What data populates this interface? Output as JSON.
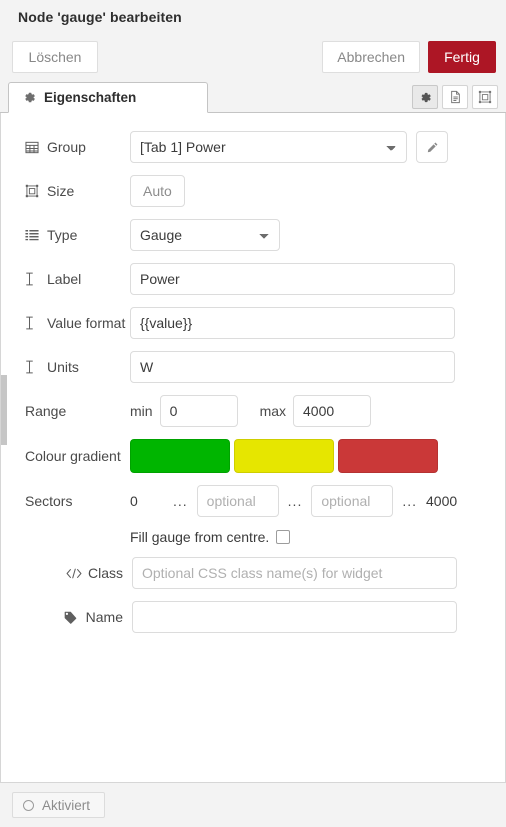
{
  "dialog": {
    "title": "Node 'gauge' bearbeiten"
  },
  "toolbar": {
    "delete_label": "Löschen",
    "cancel_label": "Abbrechen",
    "done_label": "Fertig"
  },
  "tabs": {
    "properties_label": "Eigenschaften",
    "tools": [
      {
        "name": "gear-icon",
        "active": true
      },
      {
        "name": "description-icon",
        "active": false
      },
      {
        "name": "appearance-icon",
        "active": false
      }
    ]
  },
  "form": {
    "group": {
      "label": "Group",
      "icon": "table-icon",
      "value": "[Tab 1] Power",
      "edit_button": "pencil-icon"
    },
    "size": {
      "label": "Size",
      "icon": "resize-icon",
      "value": "Auto"
    },
    "type": {
      "label": "Type",
      "icon": "list-icon",
      "value": "Gauge"
    },
    "label_field": {
      "label": "Label",
      "icon": "text-cursor-icon",
      "value": "Power"
    },
    "value_format": {
      "label": "Value format",
      "icon": "text-cursor-icon",
      "value": "{{value}}"
    },
    "units": {
      "label": "Units",
      "icon": "text-cursor-icon",
      "value": "W"
    },
    "range": {
      "label": "Range",
      "min_label": "min",
      "min_value": "0",
      "max_label": "max",
      "max_value": "4000"
    },
    "colour_gradient": {
      "label": "Colour gradient",
      "colours": [
        "#00b500",
        "#e6e600",
        "#ca3838"
      ]
    },
    "sectors": {
      "label": "Sectors",
      "start": "0",
      "separator": "...",
      "optional_1_placeholder": "optional",
      "optional_1_value": "",
      "optional_2_placeholder": "optional",
      "optional_2_value": "",
      "end": "4000"
    },
    "fill_from_centre": {
      "label": "Fill gauge from centre.",
      "checked": false
    },
    "class_field": {
      "label": "Class",
      "icon": "code-icon",
      "placeholder": "Optional CSS class name(s) for widget",
      "value": ""
    },
    "name_field": {
      "label": "Name",
      "icon": "tag-icon",
      "placeholder": "",
      "value": ""
    }
  },
  "footer": {
    "enabled_label": "Aktiviert",
    "enabled_icon": "circle-icon"
  },
  "colors": {
    "primary_button": "#ad1625",
    "border": "#dcdcdc",
    "text": "#333333"
  }
}
